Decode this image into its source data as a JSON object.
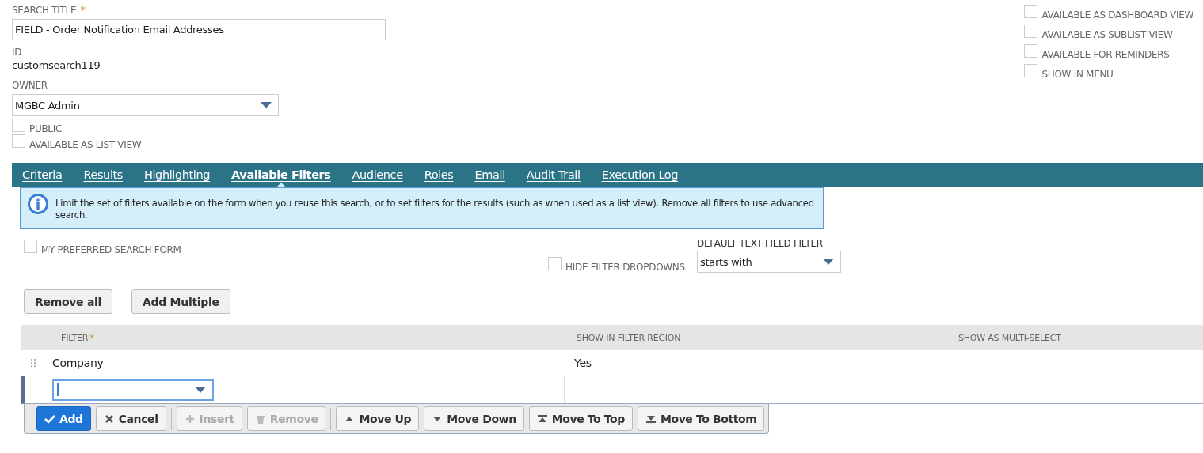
{
  "header": {
    "search_title": {
      "label": "SEARCH TITLE",
      "required_mark": "*",
      "value": "FIELD - Order Notification Email Addresses"
    },
    "id": {
      "label": "ID",
      "value": "customsearch119"
    },
    "owner": {
      "label": "OWNER",
      "value": "MGBC Admin"
    },
    "left_checks": [
      {
        "label": "PUBLIC",
        "checked": false
      },
      {
        "label": "AVAILABLE AS LIST VIEW",
        "checked": false
      }
    ],
    "right_checks": [
      {
        "label": "AVAILABLE AS DASHBOARD VIEW",
        "checked": false
      },
      {
        "label": "AVAILABLE AS SUBLIST VIEW",
        "checked": false
      },
      {
        "label": "AVAILABLE FOR REMINDERS",
        "checked": false
      },
      {
        "label": "SHOW IN MENU",
        "checked": false
      }
    ]
  },
  "tabs": [
    {
      "label": "Criteria",
      "selected": false
    },
    {
      "label": "Results",
      "selected": false
    },
    {
      "label": "Highlighting",
      "selected": false
    },
    {
      "label": "Available Filters",
      "selected": true
    },
    {
      "label": "Audience",
      "selected": false
    },
    {
      "label": "Roles",
      "selected": false
    },
    {
      "label": "Email",
      "selected": false
    },
    {
      "label": "Audit Trail",
      "selected": false
    },
    {
      "label": "Execution Log",
      "selected": false
    }
  ],
  "info": "Limit the set of filters available on the form when you reuse this search, or to set filters for the results (such as when used as a list view). Remove all filters to use advanced search.",
  "options": {
    "preferred": {
      "label": "MY PREFERRED SEARCH FORM",
      "checked": false
    },
    "hide_dropdowns": {
      "label": "HIDE FILTER DROPDOWNS",
      "checked": false
    },
    "default_filter": {
      "label": "DEFAULT TEXT FIELD FILTER",
      "value": "starts with"
    }
  },
  "actions": [
    "Remove all",
    "Add Multiple"
  ],
  "table": {
    "columns": [
      {
        "label": "FILTER",
        "required_mark": "*"
      },
      {
        "label": "SHOW IN FILTER REGION"
      },
      {
        "label": "SHOW AS MULTI-SELECT"
      }
    ],
    "rows": [
      {
        "cells": [
          "Company",
          "Yes",
          ""
        ]
      }
    ]
  },
  "row_buttons": [
    {
      "label": "Add",
      "kind": "add",
      "disabled": false
    },
    {
      "label": "Cancel",
      "kind": "cancel",
      "disabled": false
    },
    {
      "label": "Insert",
      "kind": "insert",
      "disabled": true
    },
    {
      "label": "Remove",
      "kind": "remove",
      "disabled": true
    },
    {
      "label": "Move Up",
      "kind": "up",
      "disabled": false
    },
    {
      "label": "Move Down",
      "kind": "down",
      "disabled": false
    },
    {
      "label": "Move To Top",
      "kind": "top",
      "disabled": false
    },
    {
      "label": "Move To Bottom",
      "kind": "bottom",
      "disabled": false
    }
  ]
}
